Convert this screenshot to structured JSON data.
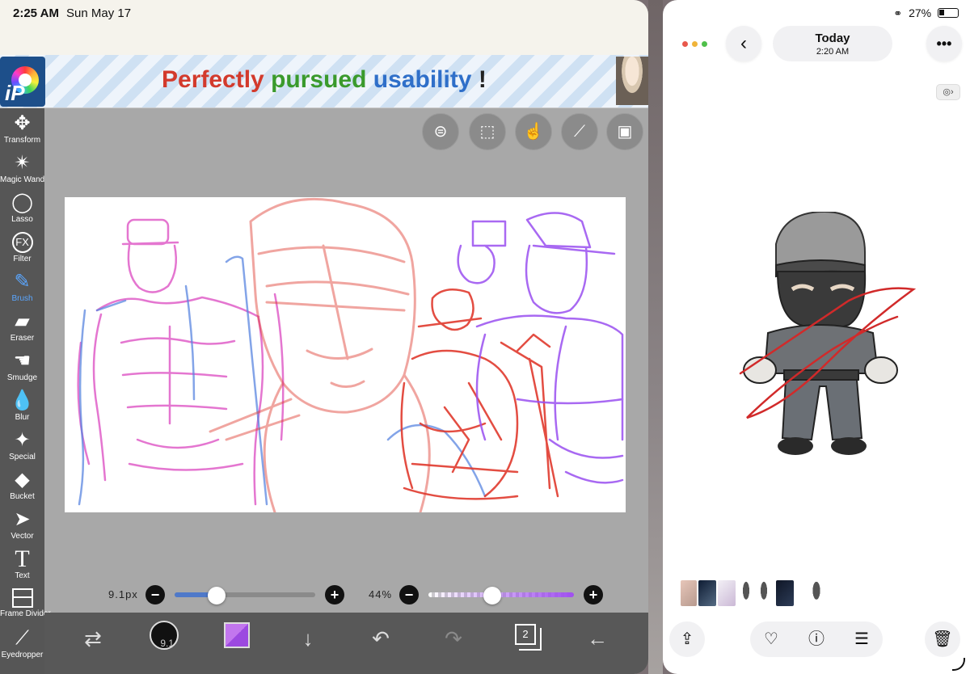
{
  "status_bar": {
    "time": "2:25 AM",
    "date": "Sun May 17",
    "battery": "27%"
  },
  "ad_banner": {
    "word1": "Perfectly",
    "word2": "pursued",
    "word3": "usability",
    "word4": "!"
  },
  "app_logo": {
    "text": "iP"
  },
  "tools": [
    {
      "label": "Transform",
      "icon": "move-icon"
    },
    {
      "label": "Magic Wand",
      "icon": "magic-wand-icon"
    },
    {
      "label": "Lasso",
      "icon": "lasso-icon"
    },
    {
      "label": "Filter",
      "icon": "fx-icon"
    },
    {
      "label": "Brush",
      "icon": "brush-icon"
    },
    {
      "label": "Eraser",
      "icon": "eraser-icon"
    },
    {
      "label": "Smudge",
      "icon": "smudge-icon"
    },
    {
      "label": "Blur",
      "icon": "blur-drop-icon"
    },
    {
      "label": "Special",
      "icon": "sparkle-icon"
    },
    {
      "label": "Bucket",
      "icon": "bucket-icon"
    },
    {
      "label": "Vector",
      "icon": "vector-arrow-icon"
    },
    {
      "label": "Text",
      "icon": "text-icon"
    },
    {
      "label": "Frame Divider",
      "icon": "frame-divider-icon"
    },
    {
      "label": "Eyedropper",
      "icon": "eyedropper-icon"
    }
  ],
  "brush_settings": {
    "size_label": "9.1px",
    "size_fraction": 0.3,
    "opacity_label": "44%",
    "opacity_fraction": 0.44,
    "brush_dot_label": "9.1",
    "color": "#a34fe8"
  },
  "bottom_bar": {
    "layers_count": "2"
  },
  "photos": {
    "title": "Today",
    "subtitle": "2:20 AM"
  },
  "colors": {
    "toolbar_bg": "#565656",
    "active_tool": "#5aa6ff",
    "canvas_bg": "#ffffff",
    "workspace_bg": "#a8a8a8",
    "sketch_red": "#e03a2e",
    "sketch_pink": "#e05fc8",
    "sketch_blue": "#5a86e0",
    "sketch_purple": "#9a4ff0"
  }
}
